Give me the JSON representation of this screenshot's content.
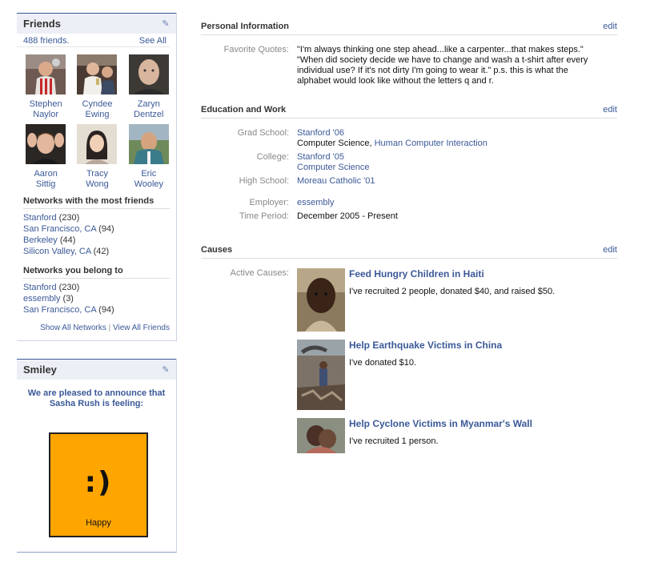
{
  "friends": {
    "title": "Friends",
    "count_label": "488 friends.",
    "see_all": "See All",
    "people": [
      {
        "first": "Stephen",
        "last": "Naylor"
      },
      {
        "first": "Cyndee",
        "last": "Ewing"
      },
      {
        "first": "Zaryn",
        "last": "Dentzel"
      },
      {
        "first": "Aaron",
        "last": "Sittig"
      },
      {
        "first": "Tracy",
        "last": "Wong"
      },
      {
        "first": "Eric",
        "last": "Wooley"
      }
    ],
    "most_friends_title": "Networks with the most friends",
    "most_friends": [
      {
        "name": "Stanford",
        "count": " (230)"
      },
      {
        "name": "San Francisco, CA",
        "count": " (94)"
      },
      {
        "name": "Berkeley",
        "count": " (44)"
      },
      {
        "name": "Silicon Valley, CA",
        "count": " (42)"
      }
    ],
    "belong_title": "Networks you belong to",
    "belong": [
      {
        "name": "Stanford",
        "count": " (230)"
      },
      {
        "name": "essembly",
        "count": " (3)"
      },
      {
        "name": "San Francisco, CA",
        "count": " (94)"
      }
    ],
    "show_all_networks": "Show All Networks",
    "separator": " | ",
    "view_all_friends": "View All Friends"
  },
  "smiley": {
    "title": "Smiley",
    "announce": "We are pleased to announce that Sasha Rush is feeling:",
    "face": ":)",
    "mood": "Happy",
    "box_color": "#ffa500"
  },
  "personal": {
    "title": "Personal Information",
    "edit": "edit",
    "quotes_label": "Favorite Quotes:",
    "quotes": "\"I'm always thinking one step ahead...like a carpenter...that makes steps.\" \"When did society decide we have to change and wash a t-shirt after every individual use? If it's not dirty I'm going to wear it.\" p.s. this is what the alphabet would look like without the letters q and r."
  },
  "education": {
    "title": "Education and Work",
    "edit": "edit",
    "grad_label": "Grad School:",
    "grad_school": "Stanford '06",
    "grad_major_plain": "Computer Science, ",
    "grad_major_link": "Human Computer Interaction",
    "college_label": "College:",
    "college": "Stanford '05",
    "college_major": "Computer Science",
    "hs_label": "High School:",
    "high_school": "Moreau Catholic '01",
    "employer_label": "Employer:",
    "employer": "essembly",
    "period_label": "Time Period:",
    "period": "December 2005 - Present"
  },
  "causes": {
    "title": "Causes",
    "edit": "edit",
    "active_label": "Active Causes:",
    "items": [
      {
        "title": "Feed Hungry Children in Haiti",
        "desc": "I've recruited 2 people, donated $40, and raised $50."
      },
      {
        "title": "Help Earthquake Victims in China",
        "desc": "I've donated $10."
      },
      {
        "title": "Help Cyclone Victims in Myanmar's Wall",
        "desc": "I've recruited 1 person."
      }
    ]
  },
  "colors": {
    "link": "#3b5998",
    "header_bg": "#eceff5",
    "smiley_orange": "#ffa500"
  }
}
